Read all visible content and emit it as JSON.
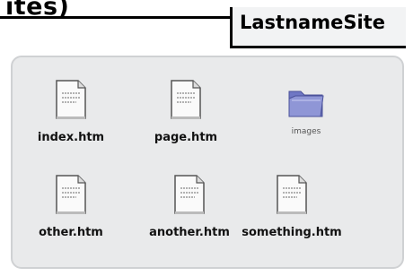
{
  "top_text": "ites)",
  "window": {
    "title": "LastnameSite"
  },
  "files": [
    {
      "name": "index.htm",
      "type": "htm",
      "icon": "html-file-icon"
    },
    {
      "name": "page.htm",
      "type": "htm",
      "icon": "html-file-icon"
    },
    {
      "name": "images",
      "type": "folder",
      "icon": "folder-icon"
    },
    {
      "name": "other.htm",
      "type": "htm",
      "icon": "html-file-icon"
    },
    {
      "name": "another.htm",
      "type": "htm",
      "icon": "html-file-icon"
    },
    {
      "name": "something.htm",
      "type": "htm",
      "icon": "html-file-icon"
    }
  ],
  "colors": {
    "folder_blue": "#8f96d6",
    "window_bg": "#e9eaeb"
  }
}
